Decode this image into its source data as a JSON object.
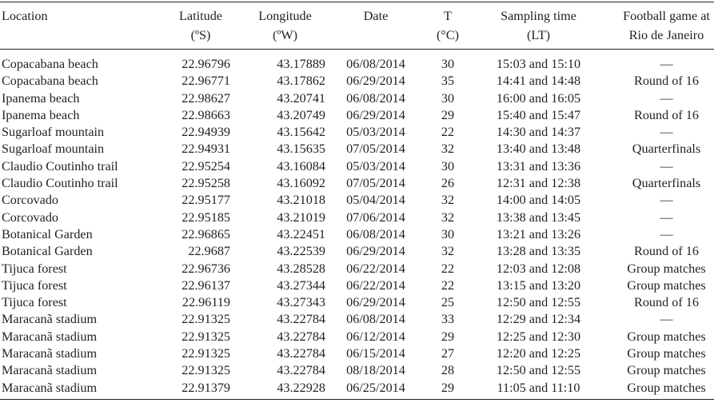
{
  "headers": {
    "location": [
      "Location"
    ],
    "latitude": [
      "Latitude",
      "(ºS)"
    ],
    "longitude": [
      "Longitude",
      "(ºW)"
    ],
    "date": [
      "Date"
    ],
    "temperature": [
      "T",
      "(°C)"
    ],
    "sampling_time": [
      "Sampling time",
      "(LT)"
    ],
    "football": [
      "Football game at",
      "Rio de Janeiro"
    ]
  },
  "rows": [
    {
      "location": "Copacabana beach",
      "latitude": "22.96796",
      "longitude": "43.17889",
      "date": "06/08/2014",
      "t": "30",
      "time": "15:03 and 15:10",
      "game": "—"
    },
    {
      "location": "Copacabana beach",
      "latitude": "22.96771",
      "longitude": "43.17862",
      "date": "06/29/2014",
      "t": "35",
      "time": "14:41 and 14:48",
      "game": "Round of 16"
    },
    {
      "location": "Ipanema beach",
      "latitude": "22.98627",
      "longitude": "43.20741",
      "date": "06/08/2014",
      "t": "30",
      "time": "16:00 and 16:05",
      "game": "—"
    },
    {
      "location": "Ipanema beach",
      "latitude": "22.98663",
      "longitude": "43.20749",
      "date": "06/29/2014",
      "t": "29",
      "time": "15:40 and 15:47",
      "game": "Round of 16"
    },
    {
      "location": "Sugarloaf mountain",
      "latitude": "22.94939",
      "longitude": "43.15642",
      "date": "05/03/2014",
      "t": "22",
      "time": "14:30 and 14:37",
      "game": "—"
    },
    {
      "location": "Sugarloaf mountain",
      "latitude": "22.94931",
      "longitude": "43.15635",
      "date": "07/05/2014",
      "t": "32",
      "time": "13:40 and 13:48",
      "game": "Quarterfinals"
    },
    {
      "location": "Claudio Coutinho trail",
      "latitude": "22.95254",
      "longitude": "43.16084",
      "date": "05/03/2014",
      "t": "30",
      "time": "13:31 and 13:36",
      "game": "—"
    },
    {
      "location": "Claudio Coutinho trail",
      "latitude": "22.95258",
      "longitude": "43.16092",
      "date": "07/05/2014",
      "t": "26",
      "time": "12:31 and 12:38",
      "game": "Quarterfinals"
    },
    {
      "location": "Corcovado",
      "latitude": "22.95177",
      "longitude": "43.21018",
      "date": "05/04/2014",
      "t": "32",
      "time": "14:00 and 14:05",
      "game": "—"
    },
    {
      "location": "Corcovado",
      "latitude": "22.95185",
      "longitude": "43.21019",
      "date": "07/06/2014",
      "t": "32",
      "time": "13:38 and 13:45",
      "game": "—"
    },
    {
      "location": "Botanical Garden",
      "latitude": "22.96865",
      "longitude": "43.22451",
      "date": "06/08/2014",
      "t": "30",
      "time": "13:21 and 13:26",
      "game": "—"
    },
    {
      "location": "Botanical Garden",
      "latitude": "22.9687",
      "longitude": "43.22539",
      "date": "06/29/2014",
      "t": "32",
      "time": "13:28 and 13:35",
      "game": "Round of 16"
    },
    {
      "location": "Tijuca forest",
      "latitude": "22.96736",
      "longitude": "43.28528",
      "date": "06/22/2014",
      "t": "22",
      "time": "12:03 and 12:08",
      "game": "Group matches"
    },
    {
      "location": "Tijuca forest",
      "latitude": "22.96137",
      "longitude": "43.27344",
      "date": "06/22/2014",
      "t": "22",
      "time": "13:15 and 13:20",
      "game": "Group matches"
    },
    {
      "location": "Tijuca forest",
      "latitude": "22.96119",
      "longitude": "43.27343",
      "date": "06/29/2014",
      "t": "25",
      "time": "12:50 and 12:55",
      "game": "Round of 16"
    },
    {
      "location": "Maracanã stadium",
      "latitude": "22.91325",
      "longitude": "43.22784",
      "date": "06/08/2014",
      "t": "33",
      "time": "12:29 and 12:34",
      "game": "—"
    },
    {
      "location": "Maracanã stadium",
      "latitude": "22.91325",
      "longitude": "43.22784",
      "date": "06/12/2014",
      "t": "29",
      "time": "12:25 and 12:30",
      "game": "Group matches"
    },
    {
      "location": "Maracanã stadium",
      "latitude": "22.91325",
      "longitude": "43.22784",
      "date": "06/15/2014",
      "t": "27",
      "time": "12:20 and 12:25",
      "game": "Group matches"
    },
    {
      "location": "Maracanã stadium",
      "latitude": "22.91325",
      "longitude": "43.22784",
      "date": "08/18/2014",
      "t": "28",
      "time": "12:50 and 12:55",
      "game": "Group matches"
    },
    {
      "location": "Maracanã stadium",
      "latitude": "22.91379",
      "longitude": "43.22928",
      "date": "06/25/2014",
      "t": "29",
      "time": "11:05 and 11:10",
      "game": "Group matches"
    }
  ]
}
